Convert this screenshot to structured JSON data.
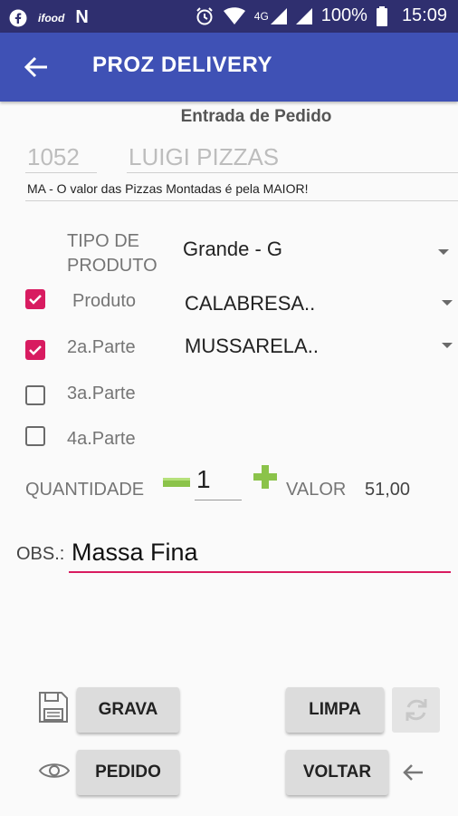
{
  "status_bar": {
    "left_icons": [
      "facebook-icon",
      "ifood-icon",
      "netflix-icon"
    ],
    "network": "4G",
    "battery": "100%",
    "time": "15:09"
  },
  "app_bar": {
    "title": "PROZ DELIVERY"
  },
  "form": {
    "header": "Entrada de Pedido",
    "code": "1052",
    "customer": "LUIGI PIZZAS",
    "note": "MA - O valor das Pizzas Montadas é pela MAIOR!",
    "tipo_produto": {
      "label_line1": "TIPO DE",
      "label_line2": "PRODUTO",
      "value": "Grande - G"
    },
    "items": [
      {
        "label": "Produto",
        "checked": true,
        "value": "CALABRESA.."
      },
      {
        "label": "2a.Parte",
        "checked": true,
        "value": "MUSSARELA.."
      },
      {
        "label": "3a.Parte",
        "checked": false,
        "value": ""
      },
      {
        "label": "4a.Parte",
        "checked": false,
        "value": ""
      }
    ],
    "quantidade_label": "QUANTIDADE",
    "quantidade": "1",
    "valor_label": "VALOR",
    "valor": "51,00",
    "obs_label": "OBS.:",
    "obs_value": "Massa Fina"
  },
  "buttons": {
    "grava": "GRAVA",
    "limpa": "LIMPA",
    "pedido": "PEDIDO",
    "voltar": "VOLTAR"
  },
  "colors": {
    "app_bar": "#3f51b5",
    "accent": "#d81b60",
    "plus_minus": "#8bc34a"
  }
}
